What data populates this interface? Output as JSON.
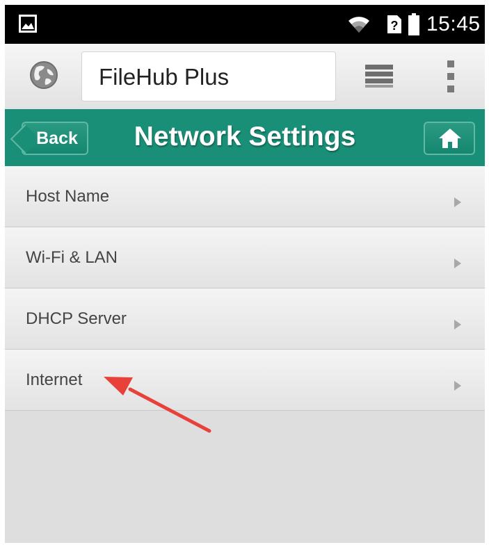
{
  "status_bar": {
    "left_icon": "image-icon",
    "wifi_icon": "wifi-icon",
    "sim_icon": "sim-unknown-icon",
    "battery_icon": "battery-icon",
    "time": "15:45"
  },
  "browser": {
    "globe_icon": "globe-icon",
    "url": "FileHub Plus",
    "tabs_icon": "tabs-icon",
    "menu_icon": "overflow-menu-icon"
  },
  "header": {
    "back_label": "Back",
    "title": "Network Settings",
    "home_icon": "home-icon",
    "color": "#1a8f77"
  },
  "settings": {
    "items": [
      {
        "label": "Host Name"
      },
      {
        "label": "Wi-Fi & LAN"
      },
      {
        "label": "DHCP Server"
      },
      {
        "label": "Internet"
      }
    ]
  },
  "annotation": {
    "arrow_color": "#e8413a",
    "target": "Internet"
  }
}
